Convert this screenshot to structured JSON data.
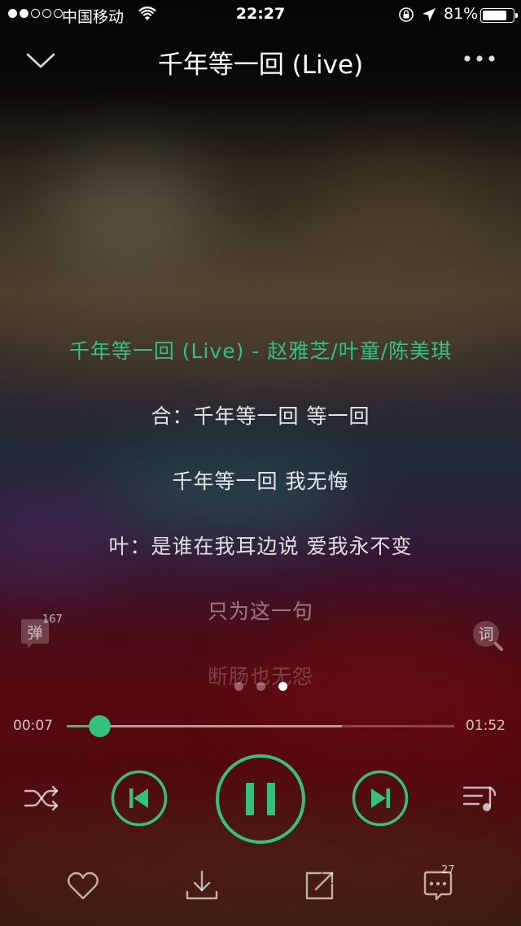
{
  "status_bar": {
    "carrier": "中国移动",
    "time": "22:27",
    "battery": "81%",
    "battery_level": 0.81
  },
  "header": {
    "title": "千年等一回 (Live)"
  },
  "lyrics": [
    "千年等一回 (Live) - 赵雅芝/叶童/陈美琪",
    "合：千年等一回 等一回",
    "千年等一回 我无悔",
    "叶：是谁在我耳边说 爱我永不变",
    "只为这一句",
    "断肠也无怨"
  ],
  "danmu": {
    "label": "弹",
    "count": "167"
  },
  "lyrics_button": {
    "label": "词"
  },
  "pager": {
    "pages": 3,
    "active": 3
  },
  "progress": {
    "current": "00:07",
    "total": "01:52",
    "played_fraction": 0.083,
    "buffered_fraction": 0.71
  },
  "comments": {
    "count": "27"
  },
  "colors": {
    "accent": "#31c27c"
  },
  "icons": {
    "collapse": "chevron-down-icon",
    "more": "more-dots-icon",
    "shuffle": "shuffle-icon",
    "prev": "skip-previous-icon",
    "pause": "pause-icon",
    "next": "skip-next-icon",
    "playlist": "playlist-icon",
    "like": "heart-icon",
    "download": "download-icon",
    "share": "share-icon",
    "comment": "comment-icon"
  }
}
